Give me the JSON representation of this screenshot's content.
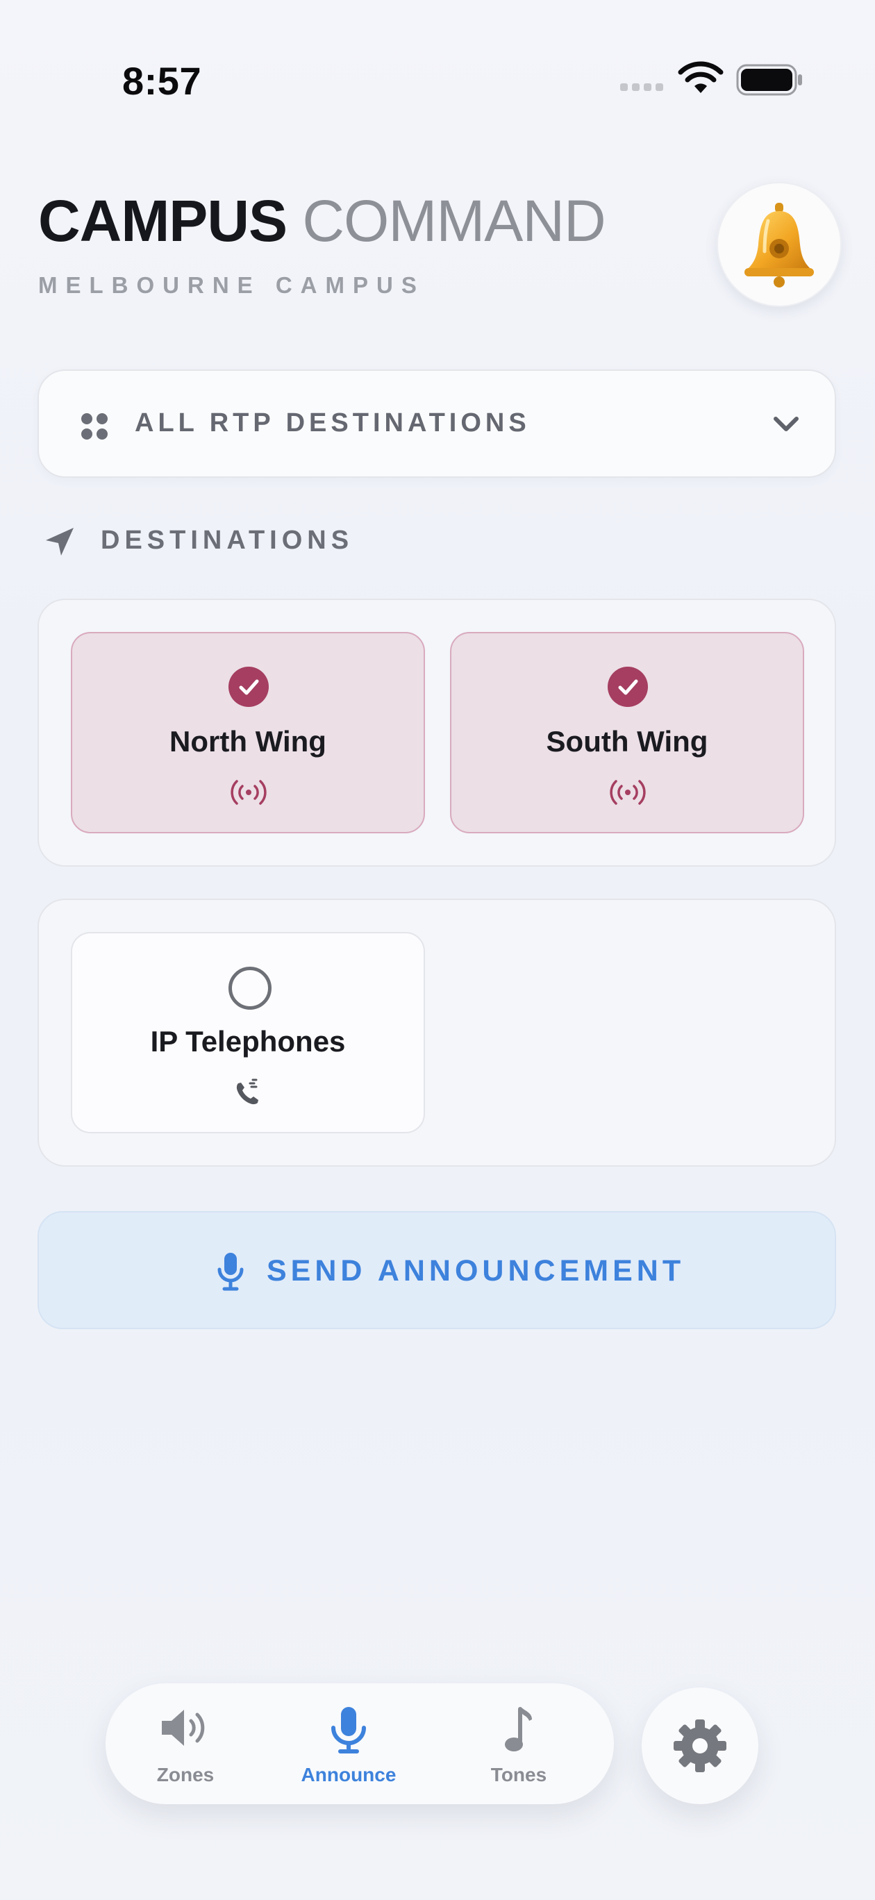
{
  "status_bar": {
    "time": "8:57"
  },
  "header": {
    "title_bold": "CAMPUS",
    "title_light": "COMMAND",
    "subtitle": "MELBOURNE CAMPUS",
    "bell_icon": "bell-icon"
  },
  "destination_filter": {
    "selected": "ALL RTP DESTINATIONS",
    "icon": "grid-icon"
  },
  "destinations_section": {
    "title": "DESTINATIONS",
    "icon": "paper-plane-icon"
  },
  "destinations": [
    {
      "name": "North Wing",
      "selected": true,
      "icon": "broadcast-icon"
    },
    {
      "name": "South Wing",
      "selected": true,
      "icon": "broadcast-icon"
    },
    {
      "name": "IP Telephones",
      "selected": false,
      "icon": "phone-icon"
    }
  ],
  "send_button": {
    "label": "SEND ANNOUNCEMENT",
    "icon": "microphone-icon"
  },
  "tabs": [
    {
      "label": "Zones",
      "icon": "speaker-icon",
      "active": false
    },
    {
      "label": "Announce",
      "icon": "microphone-icon",
      "active": true
    },
    {
      "label": "Tones",
      "icon": "music-note-icon",
      "active": false
    }
  ],
  "colors": {
    "accent_blue": "#3d82dc",
    "selected_crimson": "#a53e60",
    "selected_bg": "#ecdfe6",
    "inactive_gray": "#8a8c93"
  }
}
